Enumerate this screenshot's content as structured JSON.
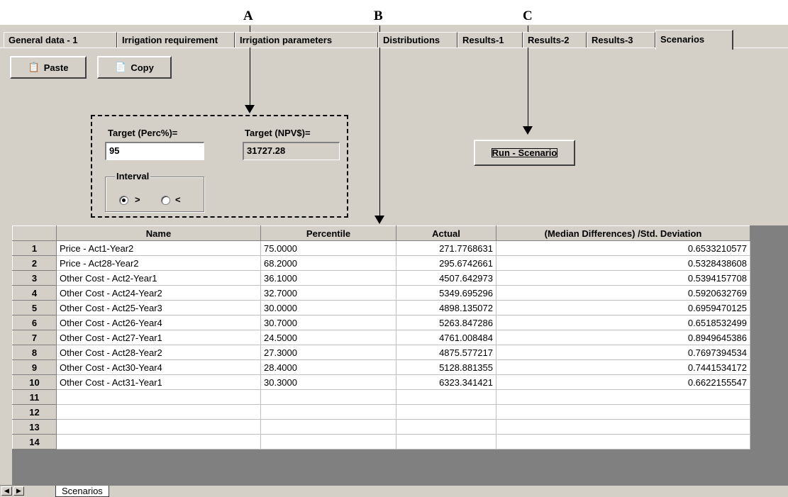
{
  "callouts": {
    "a": "A",
    "b": "B",
    "c": "C"
  },
  "tabs": [
    {
      "label": "General data - 1"
    },
    {
      "label": "Irrigation requirement"
    },
    {
      "label": "Irrigation parameters"
    },
    {
      "label": "Distributions"
    },
    {
      "label": "Results-1"
    },
    {
      "label": "Results-2"
    },
    {
      "label": "Results-3"
    },
    {
      "label": "Scenarios"
    }
  ],
  "toolbar": {
    "paste_label": "Paste",
    "copy_label": "Copy",
    "paste_icon": "clipboard-icon",
    "copy_icon": "copy-icon"
  },
  "target": {
    "perc_label": "Target (Perc%)=",
    "perc_value": "95",
    "npv_label": "Target (NPV$)=",
    "npv_value": "31727.28",
    "interval_label": "Interval",
    "gt_label": ">",
    "lt_label": "<",
    "selected": "gt"
  },
  "run_button": "Run - Scenario",
  "grid": {
    "columns": [
      "Name",
      "Percentile",
      "Actual",
      "(Median Differences) /Std. Deviation"
    ],
    "rows": [
      {
        "n": "1",
        "name": "Price - Act1-Year2",
        "percentile": "75.0000",
        "actual": "271.7768631",
        "dev": "0.6533210577"
      },
      {
        "n": "2",
        "name": "Price - Act28-Year2",
        "percentile": "68.2000",
        "actual": "295.6742661",
        "dev": "0.5328438608"
      },
      {
        "n": "3",
        "name": "Other Cost - Act2-Year1",
        "percentile": "36.1000",
        "actual": "4507.642973",
        "dev": "0.5394157708"
      },
      {
        "n": "4",
        "name": "Other Cost - Act24-Year2",
        "percentile": "32.7000",
        "actual": "5349.695296",
        "dev": "0.5920632769"
      },
      {
        "n": "5",
        "name": "Other Cost - Act25-Year3",
        "percentile": "30.0000",
        "actual": "4898.135072",
        "dev": "0.6959470125"
      },
      {
        "n": "6",
        "name": "Other Cost - Act26-Year4",
        "percentile": "30.7000",
        "actual": "5263.847286",
        "dev": "0.6518532499"
      },
      {
        "n": "7",
        "name": "Other Cost - Act27-Year1",
        "percentile": "24.5000",
        "actual": "4761.008484",
        "dev": "0.8949645386"
      },
      {
        "n": "8",
        "name": "Other Cost - Act28-Year2",
        "percentile": "27.3000",
        "actual": "4875.577217",
        "dev": "0.7697394534"
      },
      {
        "n": "9",
        "name": "Other Cost - Act30-Year4",
        "percentile": "28.4000",
        "actual": "5128.881355",
        "dev": "0.7441534172"
      },
      {
        "n": "10",
        "name": "Other Cost - Act31-Year1",
        "percentile": "30.3000",
        "actual": "6323.341421",
        "dev": "0.6622155547"
      },
      {
        "n": "11",
        "name": "",
        "percentile": "",
        "actual": "",
        "dev": ""
      },
      {
        "n": "12",
        "name": "",
        "percentile": "",
        "actual": "",
        "dev": ""
      },
      {
        "n": "13",
        "name": "",
        "percentile": "",
        "actual": "",
        "dev": ""
      },
      {
        "n": "14",
        "name": "",
        "percentile": "",
        "actual": "",
        "dev": ""
      }
    ]
  },
  "sheet_tab": "Scenarios"
}
